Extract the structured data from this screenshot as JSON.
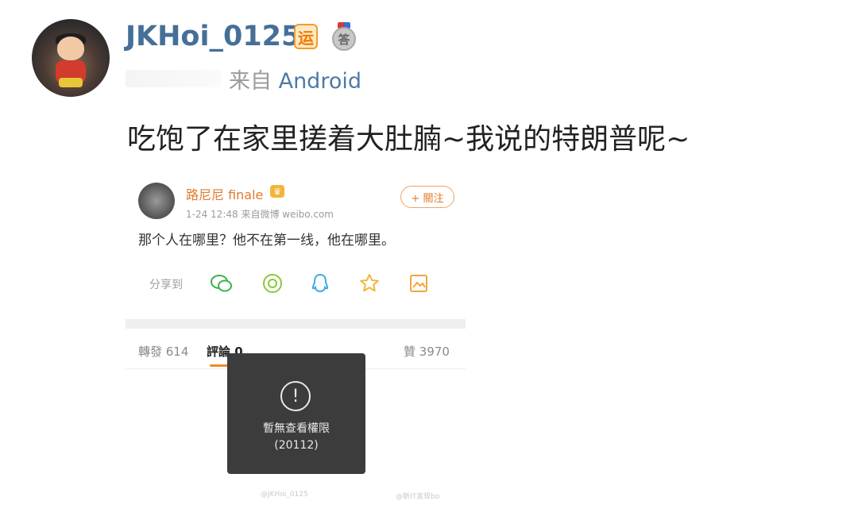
{
  "post": {
    "username": "JKHoi_0125",
    "badge_yun": "运",
    "badge_da": "答",
    "source_prefix": "来自 ",
    "source_app": "Android",
    "text": "吃饱了在家里搓着大肚腩~我说的特朗普呢~"
  },
  "embedded": {
    "author": "路尼尼 finale",
    "crown_icon": "crown-icon",
    "meta": "1-24 12:48 来自微博 weibo.com",
    "follow_label": "+ 關注",
    "text": "那个人在哪里？他不在第一线，他在哪里。",
    "share_label": "分享到",
    "share_icons": [
      "wechat-icon",
      "moments-icon",
      "qq-icon",
      "qzone-star-icon",
      "save-image-icon"
    ],
    "tabs": {
      "repost": "轉發 614",
      "comment": "評論 0",
      "like": "贊 3970"
    },
    "toast": {
      "icon": "!",
      "line1": "暫無查看權限",
      "line2": "(20112)"
    },
    "watermark_left": "@JKHoi_0125",
    "watermark_right": "@新IT发现bo"
  },
  "colors": {
    "username": "#466f98",
    "source_app": "#4d7aa8",
    "accent": "#e07a2c"
  }
}
